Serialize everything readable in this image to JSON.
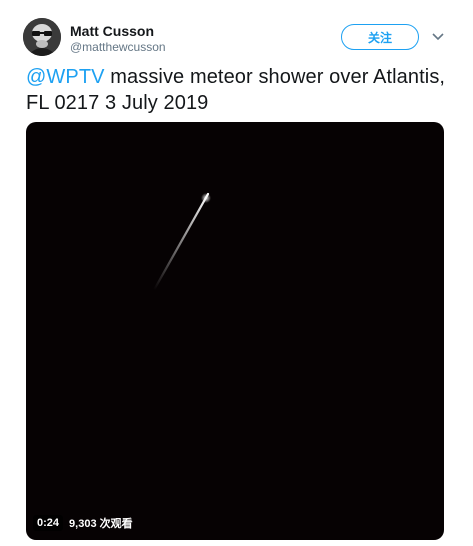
{
  "user": {
    "display_name": "Matt Cusson",
    "handle": "@matthewcusson"
  },
  "follow_button": {
    "label": "关注"
  },
  "tweet": {
    "mention": "@WPTV",
    "text": " massive meteor shower over Atlantis,\nFL 0217 3 July 2019"
  },
  "video": {
    "duration": "0:24",
    "views": "9,303 次观看"
  },
  "colors": {
    "accent": "#1da1f2",
    "text": "#14171a",
    "muted": "#657786"
  }
}
